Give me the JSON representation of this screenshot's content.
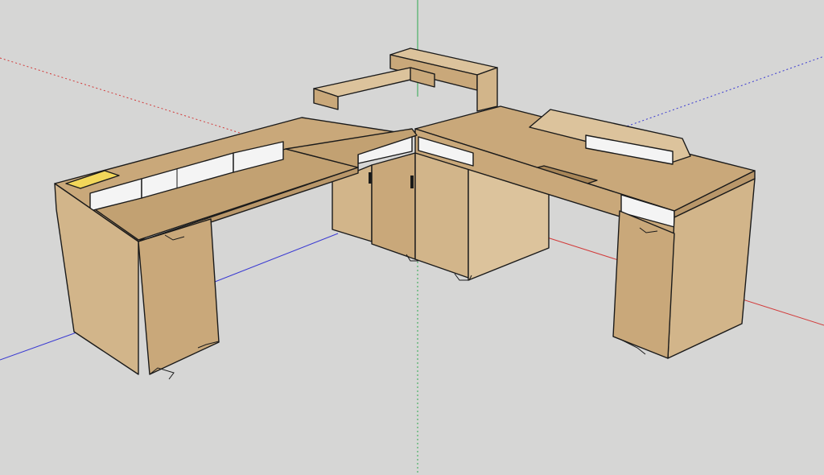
{
  "viewport": {
    "background": "#d6d6d5"
  },
  "axes": {
    "red": "#d23a3a",
    "green": "#2fa84f",
    "blue": "#3a3ad2"
  },
  "materials": {
    "wood_top": "#c9a87a",
    "wood_light": "#dcc39c",
    "wood_side": "#d2b58a",
    "wood_dark": "#b9976a",
    "drawer_white": "#f4f4f4",
    "cable_tray_yellow": "#f2d75a"
  },
  "icons": [
    "l-shaped-desk-model"
  ]
}
